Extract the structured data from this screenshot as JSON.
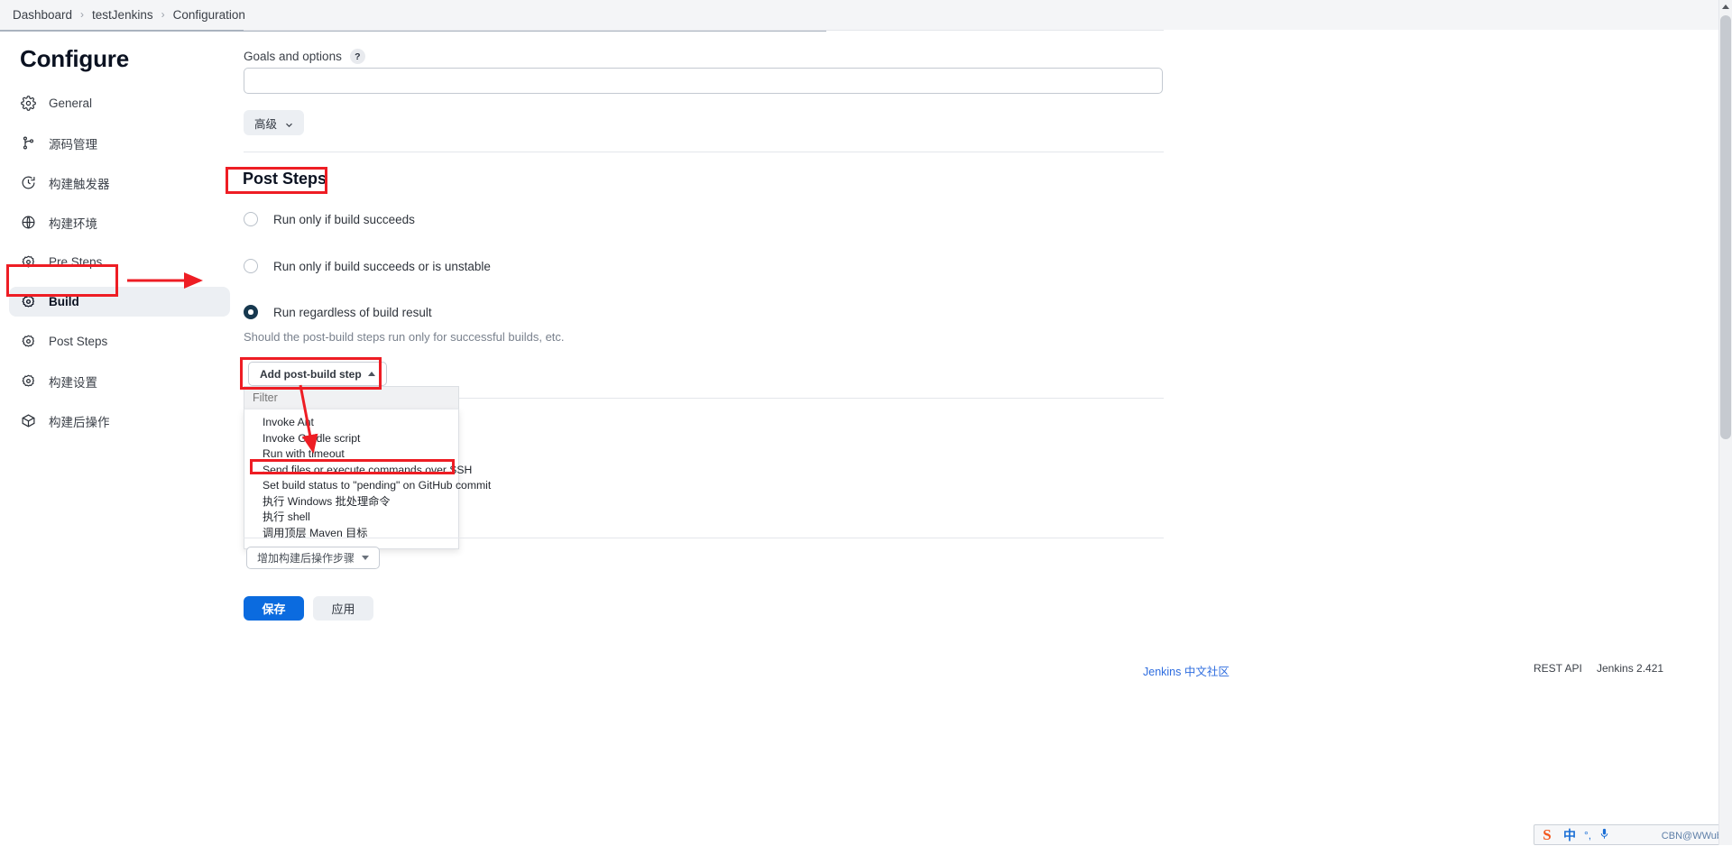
{
  "breadcrumb": {
    "items": [
      "Dashboard",
      "testJenkins",
      "Configuration"
    ],
    "separator": "›"
  },
  "page_title": "Configure",
  "sidebar": {
    "items": [
      {
        "label": "General",
        "icon": "gear-icon",
        "active": false
      },
      {
        "label": "源码管理",
        "icon": "branch-icon",
        "active": false
      },
      {
        "label": "构建触发器",
        "icon": "clock-icon",
        "active": false
      },
      {
        "label": "构建环境",
        "icon": "globe-icon",
        "active": false
      },
      {
        "label": "Pre Steps",
        "icon": "gear-icon",
        "active": false
      },
      {
        "label": "Build",
        "icon": "gear-icon",
        "active": true
      },
      {
        "label": "Post Steps",
        "icon": "gear-icon",
        "active": false
      },
      {
        "label": "构建设置",
        "icon": "gear-icon",
        "active": false
      },
      {
        "label": "构建后操作",
        "icon": "box-icon",
        "active": false
      }
    ]
  },
  "main": {
    "goals_label": "Goals and options",
    "goals_help": "?",
    "goals_value": "",
    "goals_placeholder": "",
    "advanced_label": "高级",
    "section_title": "Post Steps",
    "radios": [
      {
        "label": "Run only if build succeeds",
        "checked": false
      },
      {
        "label": "Run only if build succeeds or is unstable",
        "checked": false
      },
      {
        "label": "Run regardless of build result",
        "checked": true
      }
    ],
    "help_text": "Should the post-build steps run only for successful builds, etc.",
    "add_post_build_step_label": "Add post-build step",
    "dropdown": {
      "filter_placeholder": "Filter",
      "filter_value": "",
      "items": [
        {
          "label": "Invoke Ant",
          "highlighted": false
        },
        {
          "label": "Invoke Gradle script",
          "highlighted": false
        },
        {
          "label": "Run with timeout",
          "highlighted": false
        },
        {
          "label": "Send files or execute commands over SSH",
          "highlighted": true
        },
        {
          "label": "Set build status to \"pending\" on GitHub commit",
          "highlighted": false
        },
        {
          "label": "执行 Windows 批处理命令",
          "highlighted": false
        },
        {
          "label": "执行 shell",
          "highlighted": false
        },
        {
          "label": "调用顶层 Maven 目标",
          "highlighted": false
        }
      ]
    },
    "add_post_build_action_label": "增加构建后操作步骤",
    "save_label": "保存",
    "apply_label": "应用"
  },
  "footer": {
    "community_link": "Jenkins 中文社区",
    "rest_api": "REST API",
    "version": "Jenkins 2.421"
  },
  "ime": {
    "logo": "S",
    "mode": "中",
    "punct": "°,",
    "mic": "🎤",
    "tray": "CBN@WWub"
  },
  "colors": {
    "annotation_red": "#ee1d24",
    "primary_blue": "#0b6bdf",
    "radio_checked": "#17384f",
    "link_blue": "#2d6cdf",
    "sidebar_active_bg": "#eceff3"
  }
}
